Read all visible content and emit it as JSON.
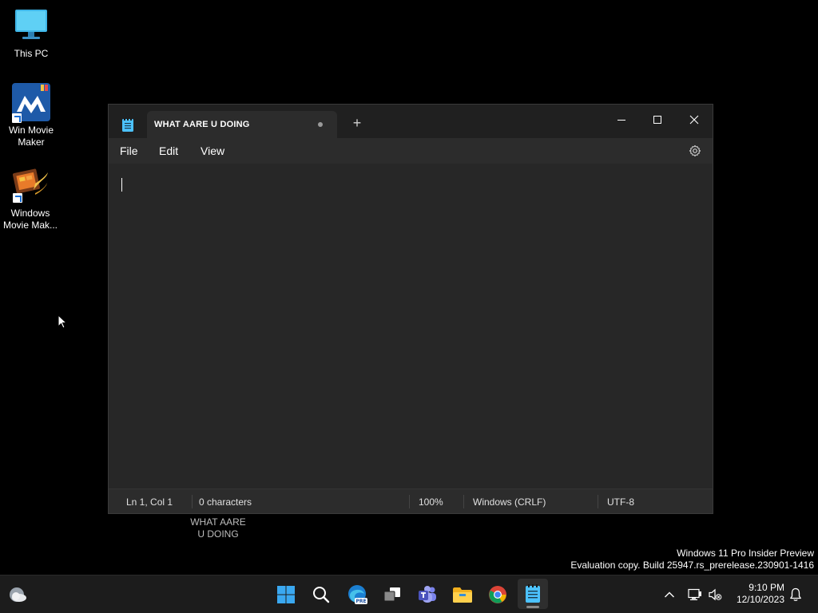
{
  "desktop": {
    "icons": [
      {
        "label": "This PC"
      },
      {
        "label": "Win Movie\nMaker"
      },
      {
        "label": "Windows\nMovie Mak..."
      }
    ],
    "floating_label": "WHAT AARE\nU DOING"
  },
  "notepad": {
    "tab_title": "WHAT AARE U DOING",
    "new_tab": "+",
    "menu": {
      "file": "File",
      "edit": "Edit",
      "view": "View"
    },
    "status": {
      "position": "Ln 1, Col 1",
      "characters": "0 characters",
      "zoom": "100%",
      "line_ending": "Windows (CRLF)",
      "encoding": "UTF-8"
    },
    "accent": "#4cc2ff"
  },
  "watermark": {
    "line1": "Windows 11 Pro Insider Preview",
    "line2": "Evaluation copy. Build 25947.rs_prerelease.230901-1416"
  },
  "taskbar": {
    "apps": [
      "start-icon",
      "search-icon",
      "edge-icon",
      "task-view-icon",
      "teams-icon",
      "file-explorer-icon",
      "chrome-icon",
      "notepad-icon"
    ],
    "edge_badge": "PRE",
    "clock": {
      "time": "9:10 PM",
      "date": "12/10/2023"
    }
  }
}
